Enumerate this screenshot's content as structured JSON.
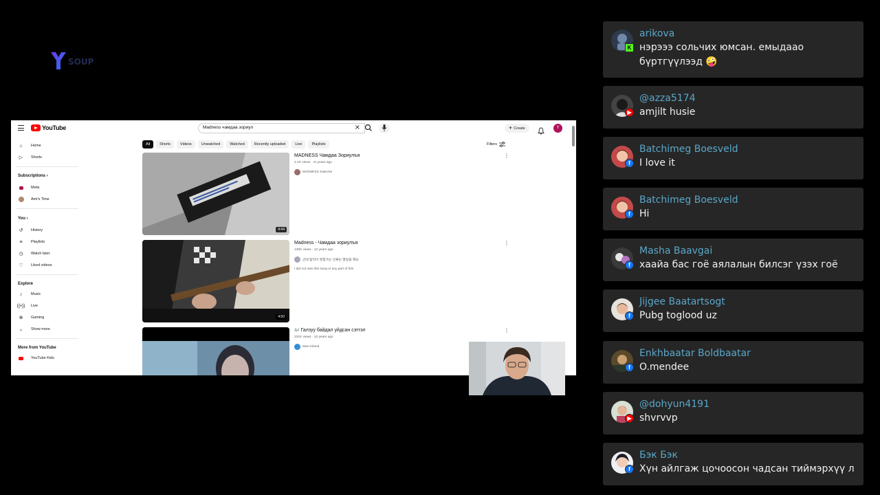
{
  "logo": {
    "letter": "Y",
    "word": "SOUP"
  },
  "youtube": {
    "brand": "YouTube",
    "search": {
      "query": "Madness чамдаа зориул"
    },
    "create_label": "Create",
    "avatar_letter": "Y",
    "sidebar": {
      "main": [
        "Home",
        "Shorts"
      ],
      "subscriptions_heading": "Subscriptions",
      "subscriptions": [
        "Meta",
        "Ami's Time"
      ],
      "you_heading": "You",
      "you": [
        "History",
        "Playlists",
        "Watch later",
        "Liked videos"
      ],
      "explore_heading": "Explore",
      "explore": [
        "Music",
        "Live",
        "Gaming",
        "Show more"
      ],
      "more_heading": "More from YouTube",
      "more": [
        "YouTube Kids"
      ]
    },
    "chips": [
      "All",
      "Shorts",
      "Videos",
      "Unwatched",
      "Watched",
      "Recently uploaded",
      "Live",
      "Playlists"
    ],
    "filters_label": "Filters",
    "results": [
      {
        "title": "MADNESS Чамдаа Зориулъя",
        "meta": "4.1K views · 11 years ago",
        "channel": "MADNESS Хамтлаг",
        "description": "",
        "duration": "4:44"
      },
      {
        "title": "Madness - Чамдаа зориулъя",
        "meta": "130K views · 12 years ago",
        "channel": "근대 탐익이 멍청가는 인류는 멸망을 해요",
        "description": "I did not own this song or any part of this",
        "duration": "4:50"
      },
      {
        "title": "Галзуу байдал уйдсан сэтгэл",
        "meta": "231K views · 10 years ago",
        "channel": "Max Khand",
        "description": "",
        "duration": ""
      }
    ]
  },
  "chat": [
    {
      "name": "arikova",
      "message": "нэрэээ сольчих юмсан. емыдаао бүртгүүлээд 🤪",
      "platform": "kick"
    },
    {
      "name": "@azza5174",
      "message": "amjilt husie",
      "platform": "youtube"
    },
    {
      "name": "Batchimeg Boesveld",
      "message": "I love it",
      "platform": "facebook"
    },
    {
      "name": "Batchimeg Boesveld",
      "message": "Hi",
      "platform": "facebook"
    },
    {
      "name": "Masha Baavgai",
      "message": "хаайа бас гоё аялалын билсэг үзэх гоё",
      "platform": "facebook"
    },
    {
      "name": "Jijgee Baatartsogt",
      "message": "Pubg toglood uz",
      "platform": "facebook"
    },
    {
      "name": "Enkhbaatar Boldbaatar",
      "message": "O.mendee",
      "platform": "facebook"
    },
    {
      "name": "@dohyun4191",
      "message": "shvrvvp",
      "platform": "youtube"
    },
    {
      "name": "Бэк Бэк",
      "message": "Хүн айлгаж цочоосон чадсан тиймэрхүү л",
      "platform": "facebook"
    }
  ],
  "colors": {
    "chat_name": "#5aa7c9",
    "chat_card_bg": "#262626",
    "youtube_red": "#ff0000",
    "facebook_blue": "#1877f2",
    "kick_green": "#53fc18"
  }
}
